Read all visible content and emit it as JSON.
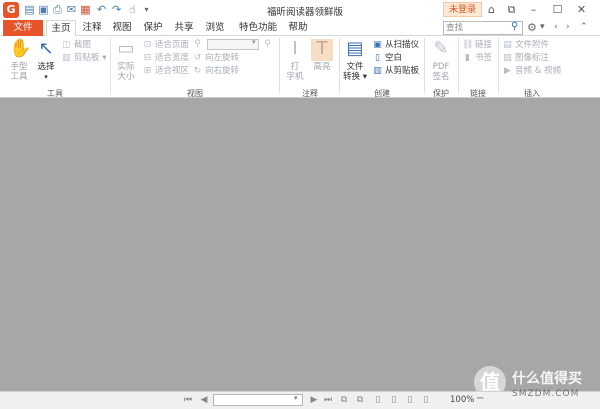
{
  "app": {
    "logo_glyph": "G",
    "window_title": "福昕阅读器领鲜版",
    "login_label": "未登录"
  },
  "tabs": {
    "file": "文件",
    "items": [
      "主页",
      "注释",
      "视图",
      "保护",
      "共享",
      "浏览",
      "特色功能",
      "帮助"
    ],
    "active_index": 0
  },
  "search": {
    "placeholder": "查找"
  },
  "ribbon": {
    "groups": {
      "tools": "工具",
      "view": "视图",
      "comment": "注释",
      "create": "创建",
      "protect": "保护",
      "link": "链接",
      "insert": "插入"
    },
    "tools": {
      "hand_line1": "手型",
      "hand_line2": "工具",
      "select": "选择",
      "snapshot": "截图",
      "clipboard": "剪贴板"
    },
    "view": {
      "actual_line1": "实际",
      "actual_line2": "大小",
      "fit_page": "适合页面",
      "fit_width": "适合宽度",
      "fit_visible": "适合视区",
      "rotate_left": "向左旋转",
      "rotate_right": "向右旋转"
    },
    "comment": {
      "typewriter_line1": "打",
      "typewriter_line2": "字机",
      "highlight": "高亮"
    },
    "create": {
      "convert_line1": "文件",
      "convert_line2": "转换",
      "from_scanner": "从扫描仪",
      "blank": "空白",
      "from_clipboard": "从剪贴板"
    },
    "protect": {
      "pdf_sign_line1": "PDF",
      "pdf_sign_line2": "签名"
    },
    "link": {
      "link": "链接",
      "bookmark": "书签"
    },
    "insert": {
      "file_attachment": "文件附件",
      "image_annotation": "图像标注",
      "audio_video": "音频 & 视频"
    }
  },
  "status": {
    "zoom": "100%"
  },
  "watermark": {
    "glyph": "值",
    "text": "什么值得买",
    "sub": "SMZDM.COM"
  }
}
